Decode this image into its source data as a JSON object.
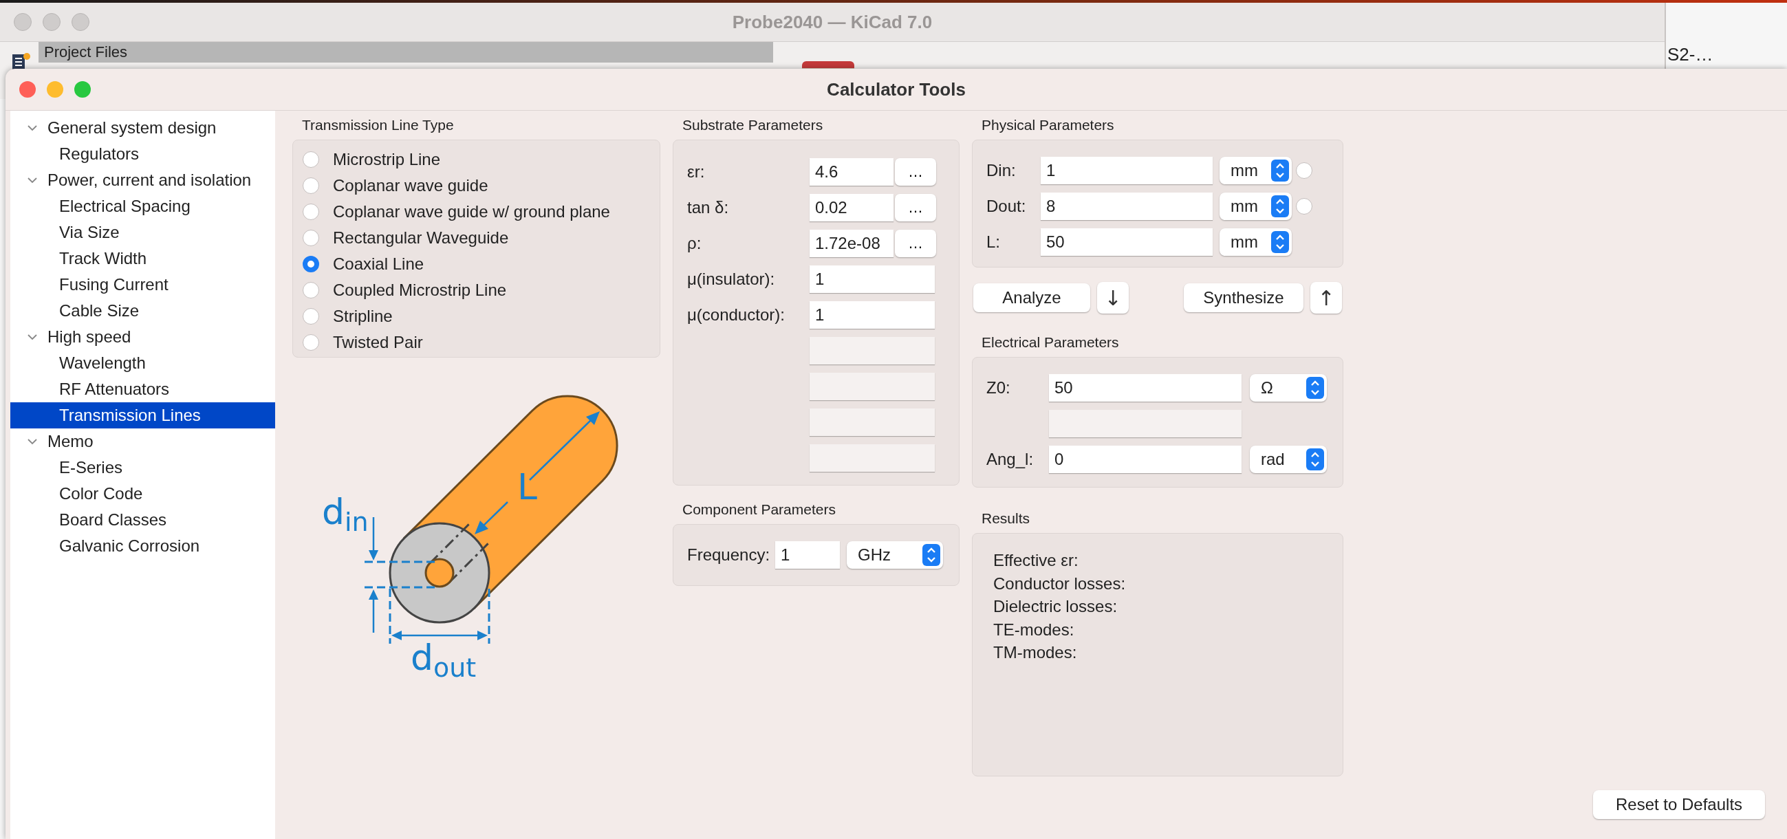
{
  "background_window": {
    "title": "Probe2040 — KiCad 7.0",
    "project_files_header": "Project Files",
    "clipped_label": "S2-…"
  },
  "window": {
    "title": "Calculator Tools"
  },
  "sidebar": {
    "groups": [
      {
        "label": "General system design",
        "expanded": true,
        "selected": false,
        "children": [
          {
            "label": "Regulators",
            "selected": false
          }
        ]
      },
      {
        "label": "Power, current and isolation",
        "expanded": true,
        "selected": false,
        "children": [
          {
            "label": "Electrical Spacing",
            "selected": false
          },
          {
            "label": "Via Size",
            "selected": false
          },
          {
            "label": "Track Width",
            "selected": false
          },
          {
            "label": "Fusing Current",
            "selected": false
          },
          {
            "label": "Cable Size",
            "selected": false
          }
        ]
      },
      {
        "label": "High speed",
        "expanded": true,
        "selected": false,
        "children": [
          {
            "label": "Wavelength",
            "selected": false
          },
          {
            "label": "RF Attenuators",
            "selected": false
          },
          {
            "label": "Transmission Lines",
            "selected": true
          }
        ]
      },
      {
        "label": "Memo",
        "expanded": true,
        "selected": false,
        "children": [
          {
            "label": "E-Series",
            "selected": false
          },
          {
            "label": "Color Code",
            "selected": false
          },
          {
            "label": "Board Classes",
            "selected": false
          },
          {
            "label": "Galvanic Corrosion",
            "selected": false
          }
        ]
      }
    ]
  },
  "transmission_line_type": {
    "title": "Transmission Line Type",
    "options": [
      {
        "label": "Microstrip Line",
        "selected": false
      },
      {
        "label": "Coplanar wave guide",
        "selected": false
      },
      {
        "label": "Coplanar wave guide w/ ground plane",
        "selected": false
      },
      {
        "label": "Rectangular Waveguide",
        "selected": false
      },
      {
        "label": "Coaxial Line",
        "selected": true
      },
      {
        "label": "Coupled Microstrip Line",
        "selected": false
      },
      {
        "label": "Stripline",
        "selected": false
      },
      {
        "label": "Twisted Pair",
        "selected": false
      }
    ]
  },
  "diagram": {
    "labels": [
      {
        "kind": "length",
        "text": "L"
      },
      {
        "kind": "inner",
        "text": "d",
        "subscript": "in"
      },
      {
        "kind": "outer",
        "text": "d",
        "subscript": "out"
      }
    ]
  },
  "substrate_parameters": {
    "title": "Substrate Parameters",
    "rows": [
      {
        "kind": "edit",
        "label": "εr:",
        "value": "4.6",
        "button": "…"
      },
      {
        "kind": "edit",
        "label": "tan δ:",
        "value": "0.02",
        "button": "…"
      },
      {
        "kind": "edit",
        "label": "ρ:",
        "value": "1.72e-08",
        "button": "…"
      },
      {
        "kind": "edit",
        "label": "μ(insulator):",
        "value": "1"
      },
      {
        "kind": "edit",
        "label": "μ(conductor):",
        "value": "1"
      },
      {
        "kind": "blank"
      },
      {
        "kind": "blank"
      },
      {
        "kind": "blank"
      },
      {
        "kind": "blank"
      }
    ]
  },
  "component_parameters": {
    "title": "Component Parameters",
    "rows": [
      {
        "label": "Frequency:",
        "value": "1",
        "unit": "GHz"
      }
    ]
  },
  "physical_parameters": {
    "title": "Physical Parameters",
    "rows": [
      {
        "kind": "with_radio",
        "label": "Din:",
        "value": "1",
        "unit": "mm",
        "selected": false
      },
      {
        "kind": "with_radio",
        "label": "Dout:",
        "value": "8",
        "unit": "mm",
        "selected": false
      },
      {
        "kind": "plain",
        "label": "L:",
        "value": "50",
        "unit": "mm"
      }
    ]
  },
  "actions": [
    {
      "label": "Analyze",
      "arrow": "↓"
    },
    {
      "label": "Synthesize",
      "arrow": "↑"
    }
  ],
  "electrical_parameters": {
    "title": "Electrical Parameters",
    "rows": [
      {
        "kind": "edit",
        "label": "Z0:",
        "value": "50",
        "unit": "Ω"
      },
      {
        "kind": "blank"
      },
      {
        "kind": "edit",
        "label": "Ang_l:",
        "value": "0",
        "unit": "rad"
      }
    ]
  },
  "results": {
    "title": "Results",
    "items": [
      "Effective εr:",
      "Conductor losses:",
      "Dielectric losses:",
      "TE-modes:",
      "TM-modes:"
    ]
  },
  "reset_button": "Reset to Defaults"
}
